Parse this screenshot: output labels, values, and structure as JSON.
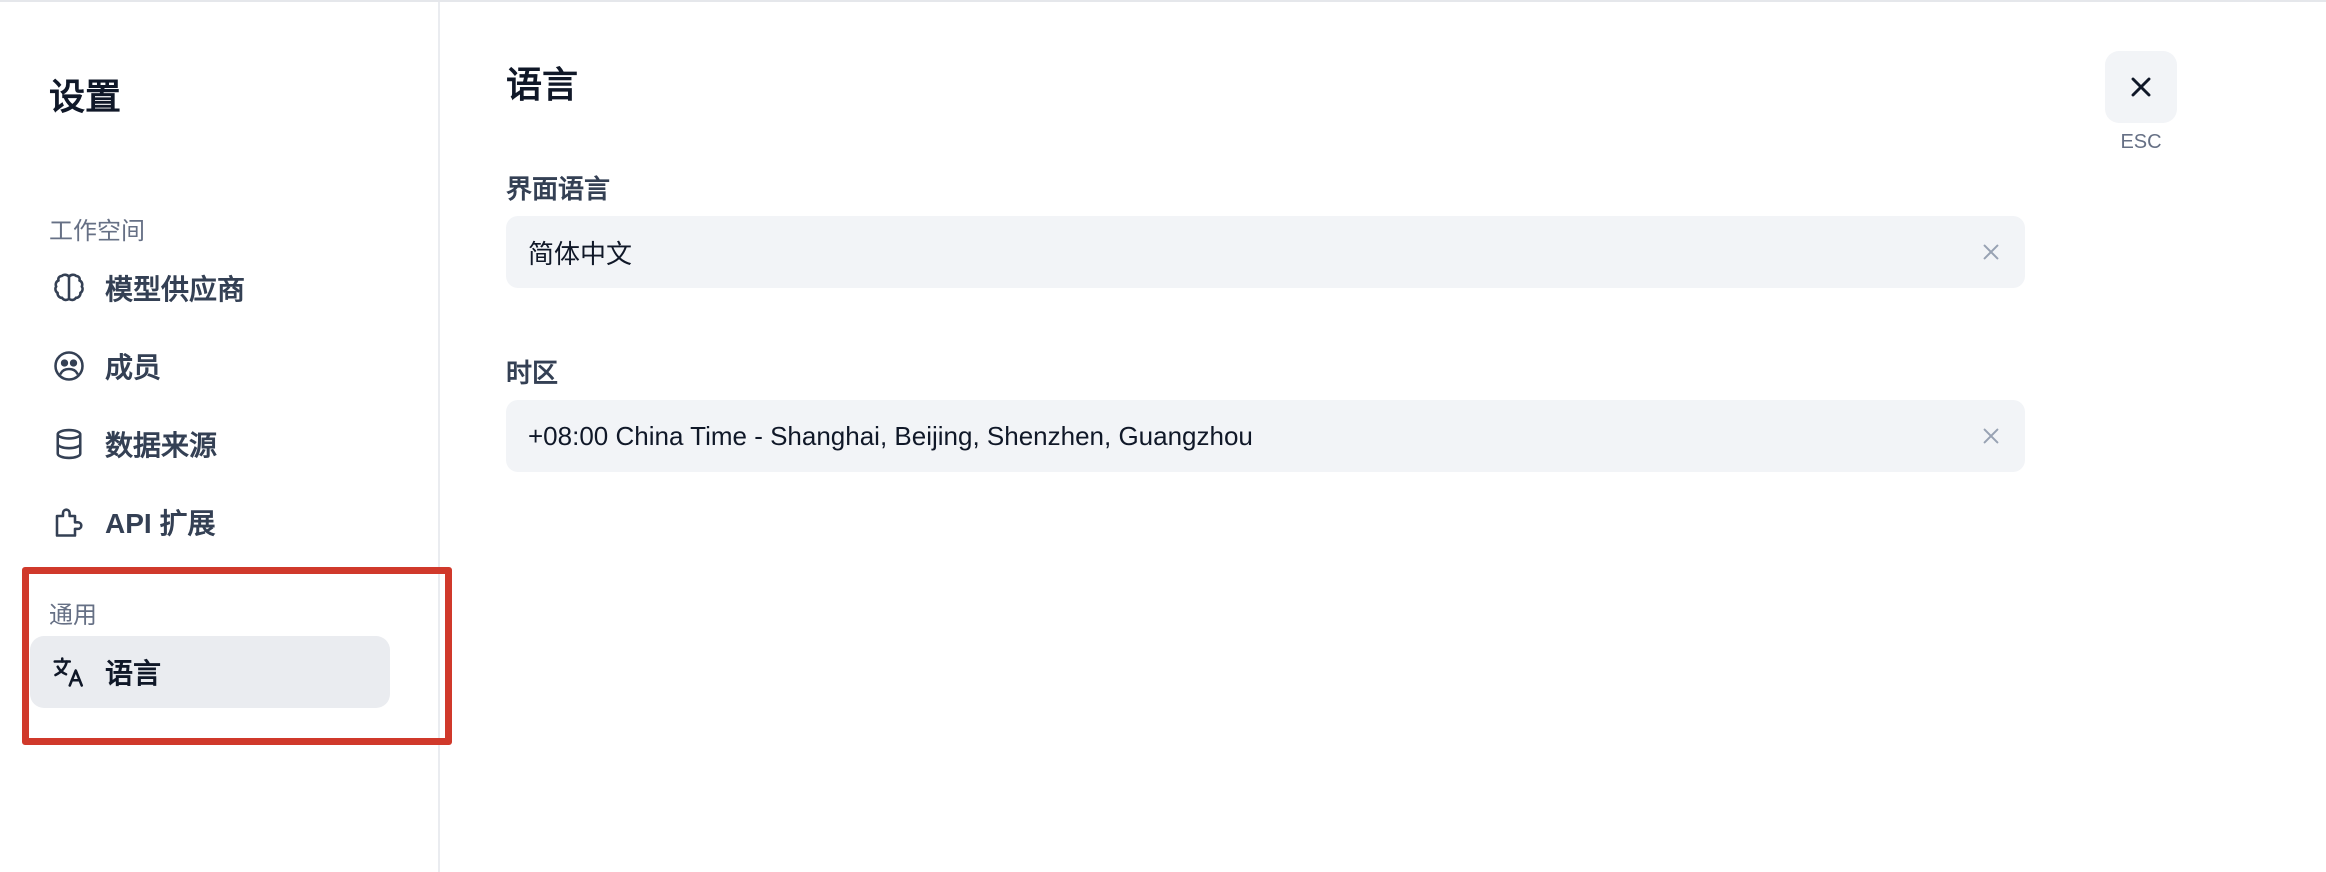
{
  "sidebar": {
    "title": "设置",
    "workspace_label": "工作空间",
    "items": [
      {
        "label": "模型供应商",
        "icon": "brain-icon"
      },
      {
        "label": "成员",
        "icon": "members-icon"
      },
      {
        "label": "数据来源",
        "icon": "database-icon"
      },
      {
        "label": "API 扩展",
        "icon": "puzzle-icon"
      }
    ],
    "general_label": "通用",
    "general_items": [
      {
        "label": "语言",
        "icon": "translate-icon",
        "active": true
      }
    ]
  },
  "main": {
    "title": "语言",
    "interface_language": {
      "label": "界面语言",
      "value": "简体中文"
    },
    "timezone": {
      "label": "时区",
      "value": "+08:00 China Time - Shanghai, Beijing, Shenzhen, Guangzhou"
    }
  },
  "close": {
    "hint": "ESC",
    "icon": "close-icon"
  },
  "colors": {
    "highlight": "#d0392b",
    "active_bg": "#eaecf0",
    "field_bg": "#f2f4f7"
  }
}
